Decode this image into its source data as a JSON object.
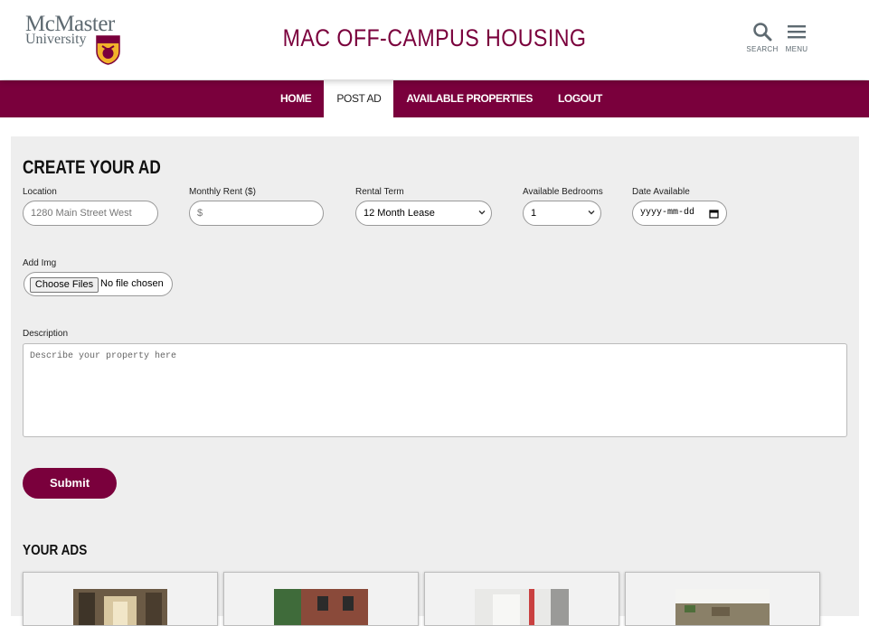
{
  "header": {
    "logo": {
      "line1": "McMaster",
      "line2": "University"
    },
    "title": "MAC OFF-CAMPUS HOUSING",
    "search_label": "SEARCH",
    "menu_label": "MENU",
    "brand_color": "#7a003c"
  },
  "nav": {
    "items": [
      "HOME",
      "POST AD",
      "AVAILABLE PROPERTIES",
      "LOGOUT"
    ],
    "active": "POST AD"
  },
  "create_ad": {
    "heading": "CREATE YOUR AD",
    "location": {
      "label": "Location",
      "placeholder": "1280 Main Street West"
    },
    "rent": {
      "label": "Monthly Rent ($)",
      "placeholder": "$"
    },
    "term": {
      "label": "Rental Term",
      "value": "12 Month Lease"
    },
    "bedrooms": {
      "label": "Available Bedrooms",
      "value": "1"
    },
    "date": {
      "label": "Date Available",
      "placeholder": "yyyy-mm-dd"
    },
    "image": {
      "label": "Add Img",
      "button": "Choose Files",
      "status": "No file chosen"
    },
    "description": {
      "label": "Description",
      "placeholder": "Describe your property here"
    },
    "submit": "Submit"
  },
  "your_ads": {
    "heading": "YOUR ADS",
    "cards": [
      {
        "thumb_icon": "hallway-photo"
      },
      {
        "thumb_icon": "brick-house-photo"
      },
      {
        "thumb_icon": "interior-photo"
      },
      {
        "thumb_icon": "building-photo"
      }
    ]
  }
}
